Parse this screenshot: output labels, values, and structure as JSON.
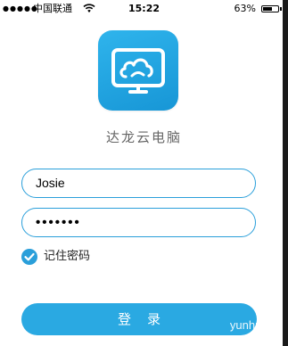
{
  "status_bar": {
    "signal_dots": "●●●●●",
    "carrier": "中国联通",
    "time": "15:22",
    "battery_percent": "63%",
    "battery_level": 0.63
  },
  "app": {
    "logo_icon": "cloud-monitor-icon",
    "name": "达龙云电脑"
  },
  "form": {
    "username_value": "Josie",
    "password_value": "•••••••",
    "remember_label": "记住密码",
    "remember_checked": true,
    "login_label": "登录"
  },
  "watermark": "yunhu.net",
  "colors": {
    "accent": "#2aa9e2",
    "border": "#2a9fda",
    "logo_gradient_start": "#2fb4ec",
    "logo_gradient_end": "#1796d6"
  }
}
